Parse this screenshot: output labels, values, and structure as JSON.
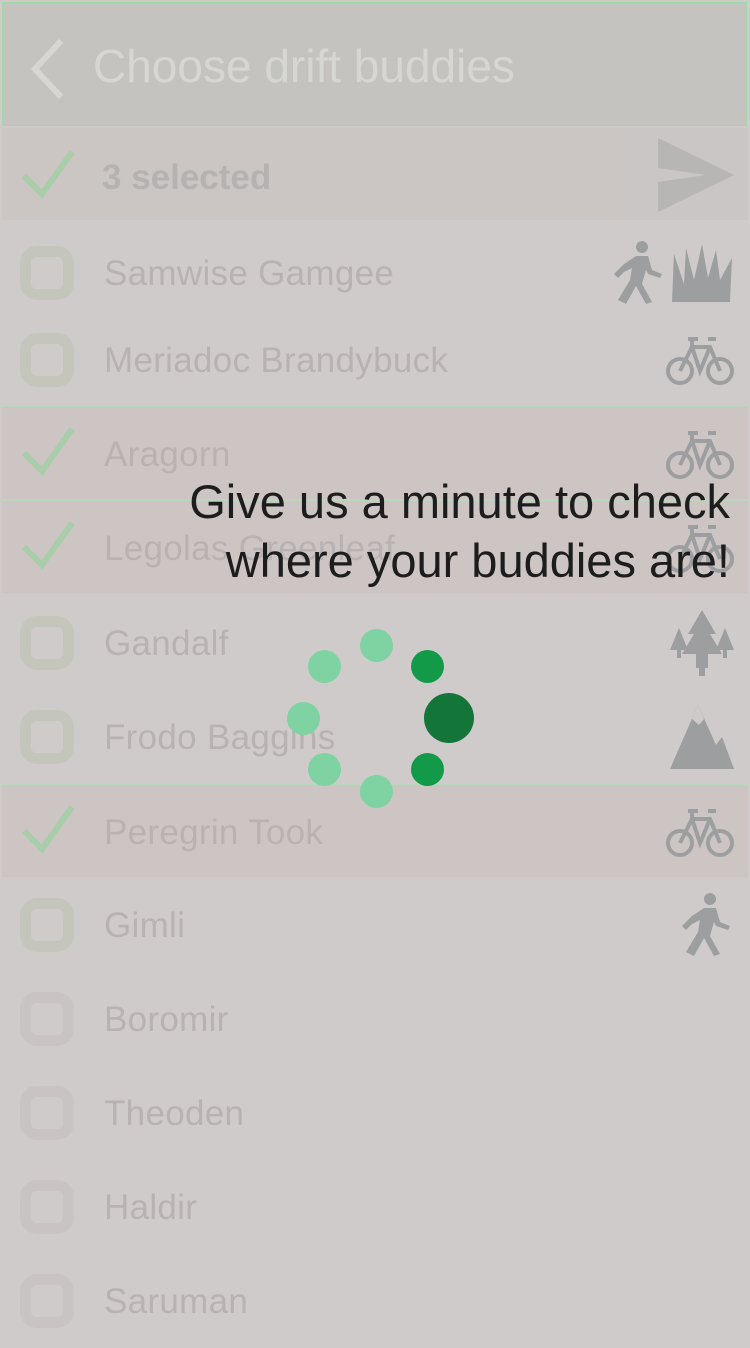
{
  "header": {
    "title": "Choose drift buddies"
  },
  "selection": {
    "count_label": "3 selected"
  },
  "buddies": [
    {
      "name": "Samwise Gamgee",
      "selected": false,
      "icons": [
        "walker-icon",
        "grass-icon"
      ]
    },
    {
      "name": "Meriadoc Brandybuck",
      "selected": false,
      "icons": [
        "bicycle-icon"
      ]
    },
    {
      "name": "Aragorn",
      "selected": true,
      "icons": [
        "bicycle-icon"
      ]
    },
    {
      "name": "Legolas Greenleaf",
      "selected": true,
      "icons": [
        "bicycle-icon"
      ]
    },
    {
      "name": "Gandalf",
      "selected": false,
      "icons": [
        "forest-icon"
      ]
    },
    {
      "name": "Frodo Baggins",
      "selected": false,
      "icons": [
        "mountain-icon"
      ]
    },
    {
      "name": "Peregrin Took",
      "selected": true,
      "icons": [
        "bicycle-icon"
      ]
    },
    {
      "name": "Gimli",
      "selected": false,
      "icons": [
        "walker-icon"
      ]
    },
    {
      "name": "Boromir",
      "selected": false,
      "icons": []
    },
    {
      "name": "Theoden",
      "selected": false,
      "icons": []
    },
    {
      "name": "Haldir",
      "selected": false,
      "icons": []
    },
    {
      "name": "Saruman",
      "selected": false,
      "icons": []
    }
  ],
  "loading": {
    "message_line1": "Give us a minute to check",
    "message_line2": "where your buddies are!"
  },
  "colors": {
    "spinner_light": "#7fd2a1",
    "spinner_mid": "#139a48",
    "spinner_dark": "#137538",
    "check_green": "#a9cda9",
    "icon_gray": "#9d9e9f"
  }
}
